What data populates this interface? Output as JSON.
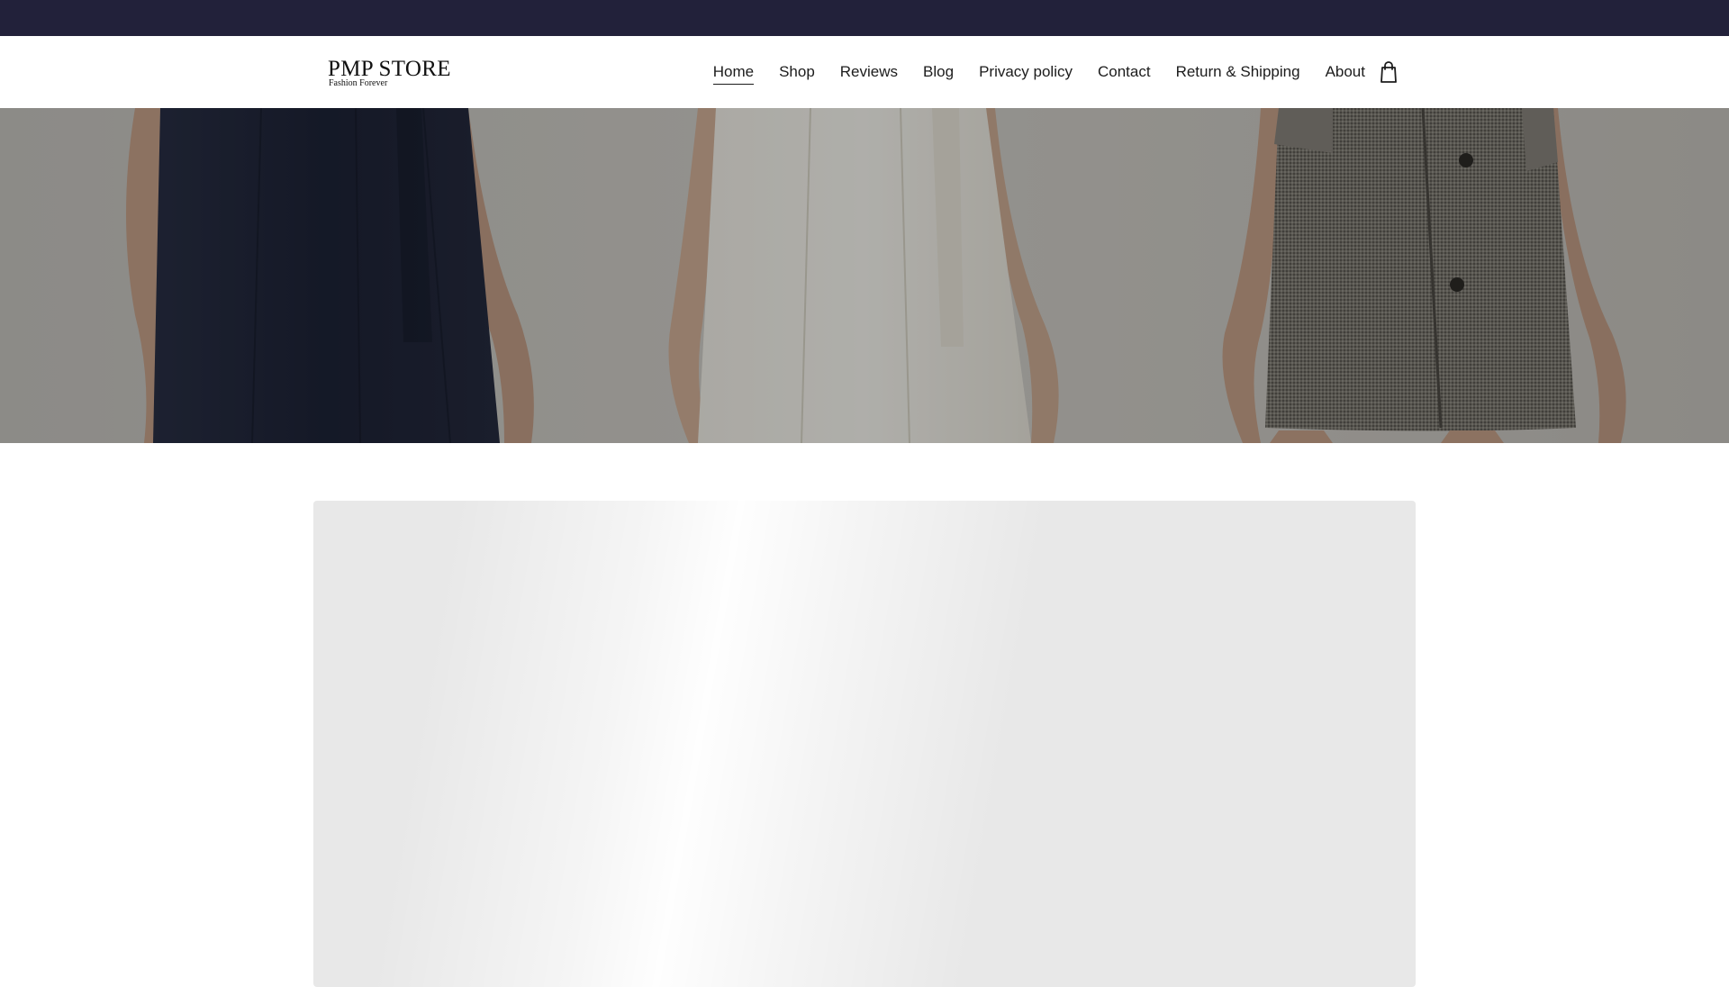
{
  "announcement_bar": {
    "background": "#22213a"
  },
  "header": {
    "logo": {
      "title": "PMP STORE",
      "tagline": "Fashion Forever"
    },
    "nav": [
      {
        "label": "Home",
        "active": true
      },
      {
        "label": "Shop",
        "active": false
      },
      {
        "label": "Reviews",
        "active": false
      },
      {
        "label": "Blog",
        "active": false
      },
      {
        "label": "Privacy policy",
        "active": false
      },
      {
        "label": "Contact",
        "active": false
      },
      {
        "label": "Return & Shipping",
        "active": false
      },
      {
        "label": "About",
        "active": false
      }
    ],
    "cart_icon": "shopping-bag-icon"
  },
  "hero": {
    "image": "three-models-dresses-photo"
  },
  "content": {
    "loading_placeholder": "image-skeleton"
  },
  "colors": {
    "text": "#1c1c1c",
    "header_bg": "#ffffff",
    "skeleton": "#e8e8e8"
  }
}
